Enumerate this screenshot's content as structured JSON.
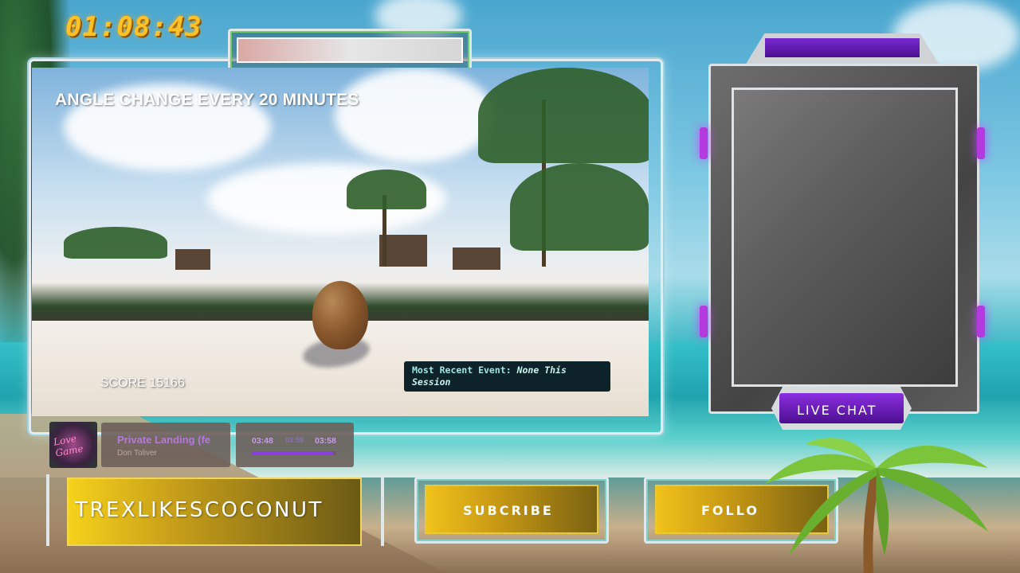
{
  "overlay": {
    "timer": "01:08:43",
    "angle_notice": "ANGLE CHANGE EVERY 20 MINUTES",
    "score_label": "SCORE 15166",
    "event_label": "Most Recent Event:",
    "event_value": "None This Session"
  },
  "music": {
    "album_art_text": "Love Game",
    "title": "Private Landing (fe",
    "artist": "Don Toliver",
    "elapsed": "03:48",
    "middle": "03:58",
    "total": "03:58",
    "progress": 0.96
  },
  "channel": {
    "name": "TREXLIKESCOCONUT"
  },
  "buttons": {
    "subscribe": "SUBCRIBE",
    "follow": "FOLLO"
  },
  "chat": {
    "label": "LIVE CHAT"
  },
  "colors": {
    "timer": "#ffc125",
    "accent_purple": "#8a3fe0",
    "plate_gold": "#f0c21a"
  }
}
